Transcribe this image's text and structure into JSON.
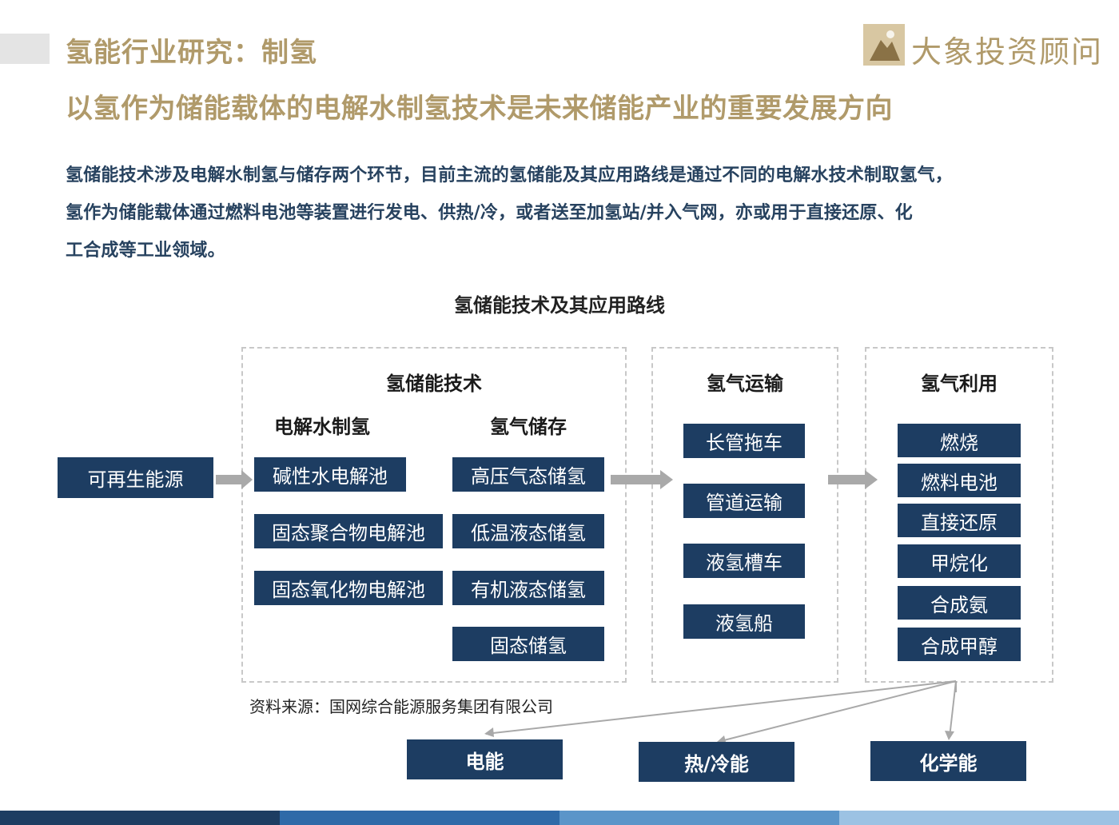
{
  "header": {
    "title": "氢能行业研究：制氢",
    "subtitle": "以氢作为储能载体的电解水制氢技术是未来储能产业的重要发展方向",
    "logo_text": "大象投资顾问"
  },
  "intro": {
    "line1": "氢储能技术涉及电解水制氢与储存两个环节，目前主流的氢储能及其应用路线是通过不同的电解水技术制取氢气，",
    "line2": "氢作为储能载体通过燃料电池等装置进行发电、供热/冷，或者送至加氢站/并入气网，亦或用于直接还原、化",
    "line3": "工合成等工业领域。"
  },
  "diagram": {
    "title": "氢储能技术及其应用路线",
    "source_node": "可再生能源",
    "storage_section": {
      "title": "氢储能技术",
      "electrolysis": {
        "heading": "电解水制氢",
        "items": [
          "碱性水电解池",
          "固态聚合物电解池",
          "固态氧化物电解池"
        ]
      },
      "hydrogen_storage": {
        "heading": "氢气储存",
        "items": [
          "高压气态储氢",
          "低温液态储氢",
          "有机液态储氢",
          "固态储氢"
        ]
      }
    },
    "transport_section": {
      "title": "氢气运输",
      "items": [
        "长管拖车",
        "管道运输",
        "液氢槽车",
        "液氢船"
      ]
    },
    "utilization_section": {
      "title": "氢气利用",
      "items": [
        "燃烧",
        "燃料电池",
        "直接还原",
        "甲烷化",
        "合成氨",
        "合成甲醇"
      ]
    },
    "outputs": [
      "电能",
      "热/冷能",
      "化学能"
    ]
  },
  "source_note": "资料来源：国网综合能源服务集团有限公司",
  "colors": {
    "accent_gold": "#b09a6a",
    "box_navy": "#1d3d62",
    "body_blue": "#27425f",
    "arrow_gray": "#a9a9a9"
  }
}
